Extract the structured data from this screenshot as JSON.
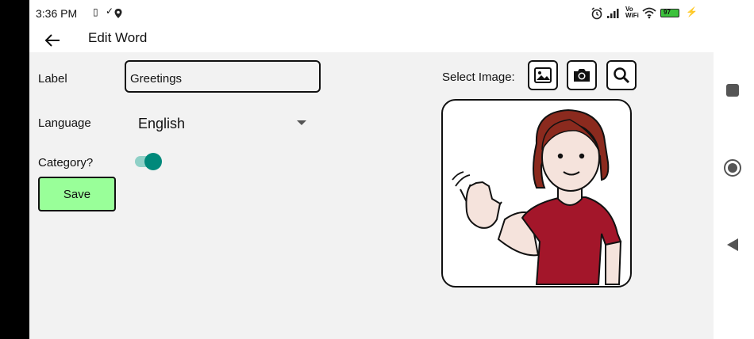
{
  "status_bar": {
    "time": "3:36 PM",
    "battery": "97",
    "network_label_top": "Vo",
    "network_label_bottom": "WiFi"
  },
  "app_bar": {
    "title": "Edit Word"
  },
  "form": {
    "label_caption": "Label",
    "label_value": "Greetings",
    "language_caption": "Language",
    "language_value": "English",
    "category_caption": "Category?",
    "category_enabled": true,
    "save_label": "Save"
  },
  "image_panel": {
    "caption": "Select Image:"
  },
  "colors": {
    "accent": "#00897b",
    "save_bg": "#99ff99",
    "content_bg": "#f2f2f2",
    "shirt": "#a3162a",
    "hair": "#8b2a1e"
  }
}
